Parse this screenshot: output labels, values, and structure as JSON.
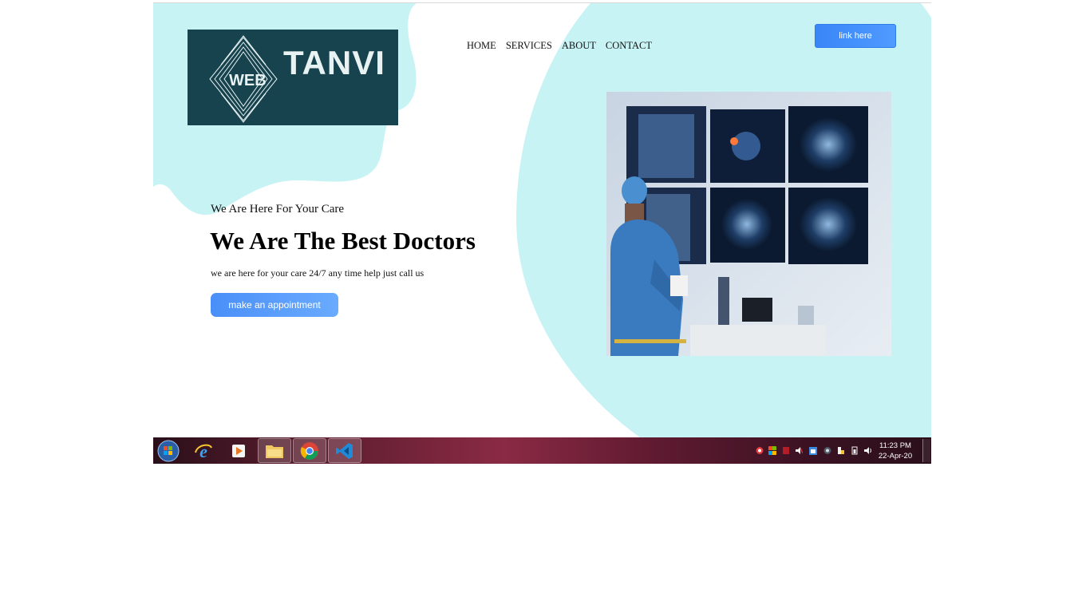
{
  "brand": {
    "logo_small": "WEB",
    "logo_name": "TANVI"
  },
  "nav": {
    "items": [
      "HOME",
      "SERVICES",
      "ABOUT",
      "CONTACT"
    ]
  },
  "header": {
    "link_button": "link here"
  },
  "hero": {
    "tagline": "We Are Here For Your Care",
    "headline": "We Are The Best Doctors",
    "subtext": "we are here for your care 24/7 any time help just call us",
    "cta": "make an appointment"
  },
  "taskbar": {
    "apps": [
      "start-button",
      "internet-explorer",
      "media-player",
      "file-explorer",
      "chrome",
      "vscode"
    ],
    "clock_time": "11:23 PM",
    "clock_date": "22-Apr-20"
  },
  "colors": {
    "accent": "#c8f3f4",
    "logo_bg": "#17434f",
    "button": "#3a86f8"
  }
}
